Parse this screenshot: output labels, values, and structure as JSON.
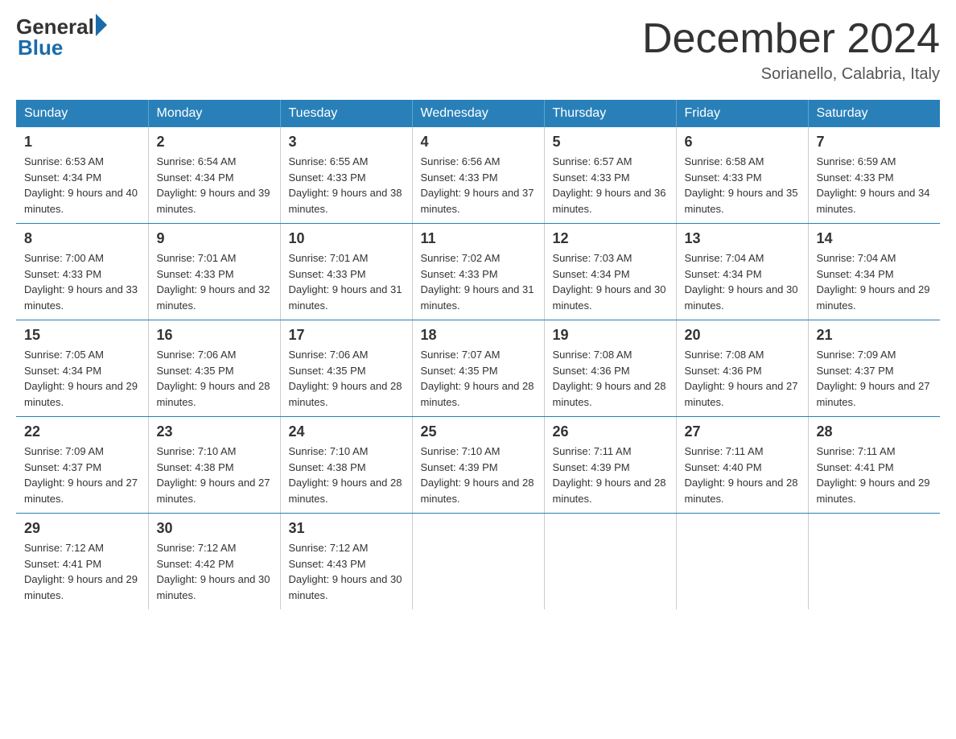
{
  "header": {
    "logo_general": "General",
    "logo_blue": "Blue",
    "title": "December 2024",
    "location": "Sorianello, Calabria, Italy"
  },
  "days_of_week": [
    "Sunday",
    "Monday",
    "Tuesday",
    "Wednesday",
    "Thursday",
    "Friday",
    "Saturday"
  ],
  "weeks": [
    [
      {
        "day": "1",
        "sunrise": "6:53 AM",
        "sunset": "4:34 PM",
        "daylight": "9 hours and 40 minutes."
      },
      {
        "day": "2",
        "sunrise": "6:54 AM",
        "sunset": "4:34 PM",
        "daylight": "9 hours and 39 minutes."
      },
      {
        "day": "3",
        "sunrise": "6:55 AM",
        "sunset": "4:33 PM",
        "daylight": "9 hours and 38 minutes."
      },
      {
        "day": "4",
        "sunrise": "6:56 AM",
        "sunset": "4:33 PM",
        "daylight": "9 hours and 37 minutes."
      },
      {
        "day": "5",
        "sunrise": "6:57 AM",
        "sunset": "4:33 PM",
        "daylight": "9 hours and 36 minutes."
      },
      {
        "day": "6",
        "sunrise": "6:58 AM",
        "sunset": "4:33 PM",
        "daylight": "9 hours and 35 minutes."
      },
      {
        "day": "7",
        "sunrise": "6:59 AM",
        "sunset": "4:33 PM",
        "daylight": "9 hours and 34 minutes."
      }
    ],
    [
      {
        "day": "8",
        "sunrise": "7:00 AM",
        "sunset": "4:33 PM",
        "daylight": "9 hours and 33 minutes."
      },
      {
        "day": "9",
        "sunrise": "7:01 AM",
        "sunset": "4:33 PM",
        "daylight": "9 hours and 32 minutes."
      },
      {
        "day": "10",
        "sunrise": "7:01 AM",
        "sunset": "4:33 PM",
        "daylight": "9 hours and 31 minutes."
      },
      {
        "day": "11",
        "sunrise": "7:02 AM",
        "sunset": "4:33 PM",
        "daylight": "9 hours and 31 minutes."
      },
      {
        "day": "12",
        "sunrise": "7:03 AM",
        "sunset": "4:34 PM",
        "daylight": "9 hours and 30 minutes."
      },
      {
        "day": "13",
        "sunrise": "7:04 AM",
        "sunset": "4:34 PM",
        "daylight": "9 hours and 30 minutes."
      },
      {
        "day": "14",
        "sunrise": "7:04 AM",
        "sunset": "4:34 PM",
        "daylight": "9 hours and 29 minutes."
      }
    ],
    [
      {
        "day": "15",
        "sunrise": "7:05 AM",
        "sunset": "4:34 PM",
        "daylight": "9 hours and 29 minutes."
      },
      {
        "day": "16",
        "sunrise": "7:06 AM",
        "sunset": "4:35 PM",
        "daylight": "9 hours and 28 minutes."
      },
      {
        "day": "17",
        "sunrise": "7:06 AM",
        "sunset": "4:35 PM",
        "daylight": "9 hours and 28 minutes."
      },
      {
        "day": "18",
        "sunrise": "7:07 AM",
        "sunset": "4:35 PM",
        "daylight": "9 hours and 28 minutes."
      },
      {
        "day": "19",
        "sunrise": "7:08 AM",
        "sunset": "4:36 PM",
        "daylight": "9 hours and 28 minutes."
      },
      {
        "day": "20",
        "sunrise": "7:08 AM",
        "sunset": "4:36 PM",
        "daylight": "9 hours and 27 minutes."
      },
      {
        "day": "21",
        "sunrise": "7:09 AM",
        "sunset": "4:37 PM",
        "daylight": "9 hours and 27 minutes."
      }
    ],
    [
      {
        "day": "22",
        "sunrise": "7:09 AM",
        "sunset": "4:37 PM",
        "daylight": "9 hours and 27 minutes."
      },
      {
        "day": "23",
        "sunrise": "7:10 AM",
        "sunset": "4:38 PM",
        "daylight": "9 hours and 27 minutes."
      },
      {
        "day": "24",
        "sunrise": "7:10 AM",
        "sunset": "4:38 PM",
        "daylight": "9 hours and 28 minutes."
      },
      {
        "day": "25",
        "sunrise": "7:10 AM",
        "sunset": "4:39 PM",
        "daylight": "9 hours and 28 minutes."
      },
      {
        "day": "26",
        "sunrise": "7:11 AM",
        "sunset": "4:39 PM",
        "daylight": "9 hours and 28 minutes."
      },
      {
        "day": "27",
        "sunrise": "7:11 AM",
        "sunset": "4:40 PM",
        "daylight": "9 hours and 28 minutes."
      },
      {
        "day": "28",
        "sunrise": "7:11 AM",
        "sunset": "4:41 PM",
        "daylight": "9 hours and 29 minutes."
      }
    ],
    [
      {
        "day": "29",
        "sunrise": "7:12 AM",
        "sunset": "4:41 PM",
        "daylight": "9 hours and 29 minutes."
      },
      {
        "day": "30",
        "sunrise": "7:12 AM",
        "sunset": "4:42 PM",
        "daylight": "9 hours and 30 minutes."
      },
      {
        "day": "31",
        "sunrise": "7:12 AM",
        "sunset": "4:43 PM",
        "daylight": "9 hours and 30 minutes."
      },
      null,
      null,
      null,
      null
    ]
  ]
}
